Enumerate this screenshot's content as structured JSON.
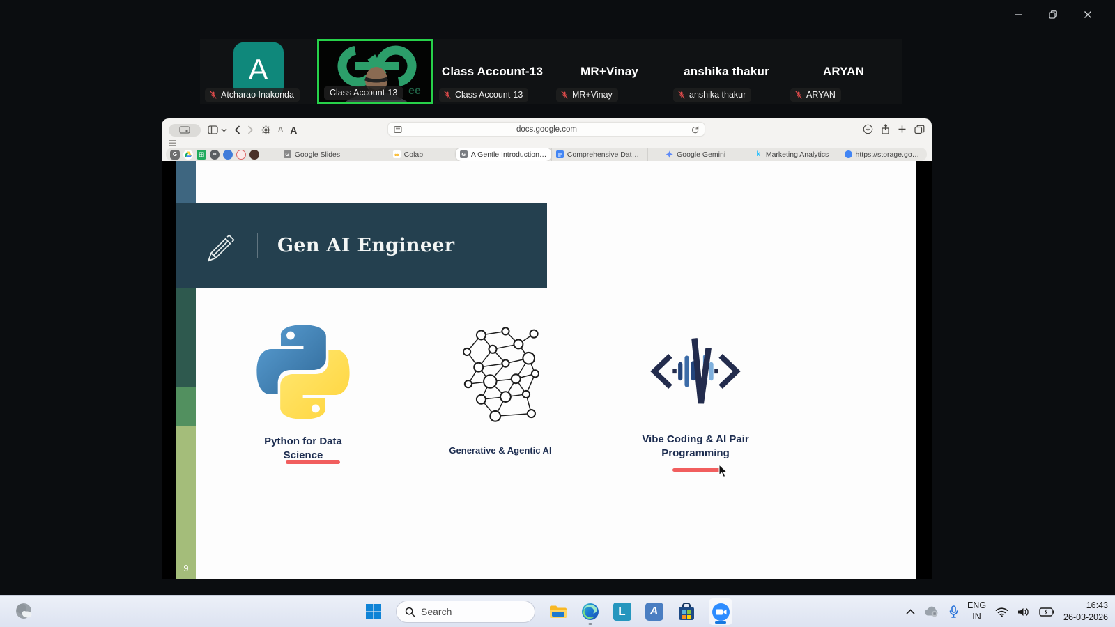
{
  "participants": [
    {
      "display_name": "Atcharao Inakonda",
      "label": "Atcharao Inakonda",
      "avatar_letter": "A",
      "muted": true
    },
    {
      "display_name": "Class Account-13",
      "label": "Class Account-13",
      "muted": false,
      "video": true,
      "active_speaker": true
    },
    {
      "display_name": "Class Account-13",
      "label": "Class Account-13",
      "muted": true
    },
    {
      "display_name": "MR+Vinay",
      "label": "MR+Vinay",
      "muted": true
    },
    {
      "display_name": "anshika thakur",
      "label": "anshika thakur",
      "muted": true
    },
    {
      "display_name": "ARYAN",
      "label": "ARYAN",
      "muted": true
    }
  ],
  "browser": {
    "address": "docs.google.com",
    "font_smaller": "A",
    "font_larger": "A",
    "tabs": [
      {
        "label": "Google Slides",
        "icon": "google-slides"
      },
      {
        "label": "Colab",
        "icon": "colab"
      },
      {
        "label": "A Gentle Introduction to Yo...",
        "icon": "slides-doc",
        "active": true
      },
      {
        "label": "Comprehensive Data Analysi...",
        "icon": "doc-blue"
      },
      {
        "label": "Google Gemini",
        "icon": "gemini-sparkle"
      },
      {
        "label": "Marketing Analytics",
        "icon": "kaggle-k"
      },
      {
        "label": "https://storage.googleapis.c...",
        "icon": "globe-blue"
      }
    ]
  },
  "slide": {
    "title": "Gen AI Engineer",
    "page_number": "9",
    "header_bg": "#24404f",
    "accent_red": "#f15e5e",
    "items": [
      {
        "label": "Python for Data Science",
        "icon": "python-logo",
        "underlined": true
      },
      {
        "label": "Generative & Agentic AI",
        "icon": "neural-network",
        "underlined": false
      },
      {
        "label": "Vibe Coding & AI Pair Programming",
        "icon": "vibe-coding",
        "underlined": true
      }
    ]
  },
  "taskbar": {
    "search_placeholder": "Search",
    "language": {
      "line1": "ENG",
      "line2": "IN"
    },
    "clock": {
      "time": "16:43",
      "date": "26-03-2026"
    }
  }
}
